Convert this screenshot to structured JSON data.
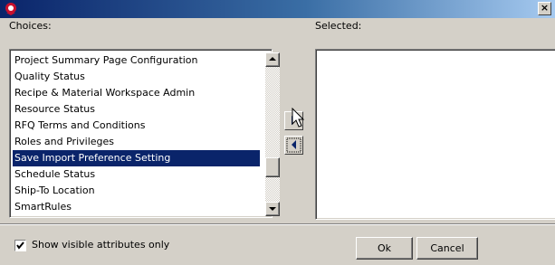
{
  "window": {
    "title": "",
    "app_icon": "app-logo-icon",
    "close_glyph": "×"
  },
  "choices": {
    "label": "Choices:",
    "items": [
      {
        "label": "Project Summary Page Configuration",
        "selected": false
      },
      {
        "label": "Quality Status",
        "selected": false
      },
      {
        "label": "Recipe & Material Workspace Admin",
        "selected": false
      },
      {
        "label": "Resource Status",
        "selected": false
      },
      {
        "label": "RFQ Terms and Conditions",
        "selected": false
      },
      {
        "label": "Roles and Privileges",
        "selected": false
      },
      {
        "label": "Save Import Preference Setting",
        "selected": true
      },
      {
        "label": "Schedule Status",
        "selected": false
      },
      {
        "label": "Ship-To Location",
        "selected": false
      },
      {
        "label": "SmartRules",
        "selected": false
      }
    ]
  },
  "selected": {
    "label": "Selected:",
    "items": []
  },
  "move_buttons": {
    "add_icon": "move-right-icon",
    "remove_icon": "move-left-icon"
  },
  "footer": {
    "checkbox_label": "Show visible attributes only",
    "checkbox_checked": true,
    "ok_label": "Ok",
    "cancel_label": "Cancel"
  },
  "colors": {
    "selection": "#0a246a",
    "face": "#d4d0c8",
    "title_start": "#0a246a",
    "title_end": "#a6caf0"
  }
}
